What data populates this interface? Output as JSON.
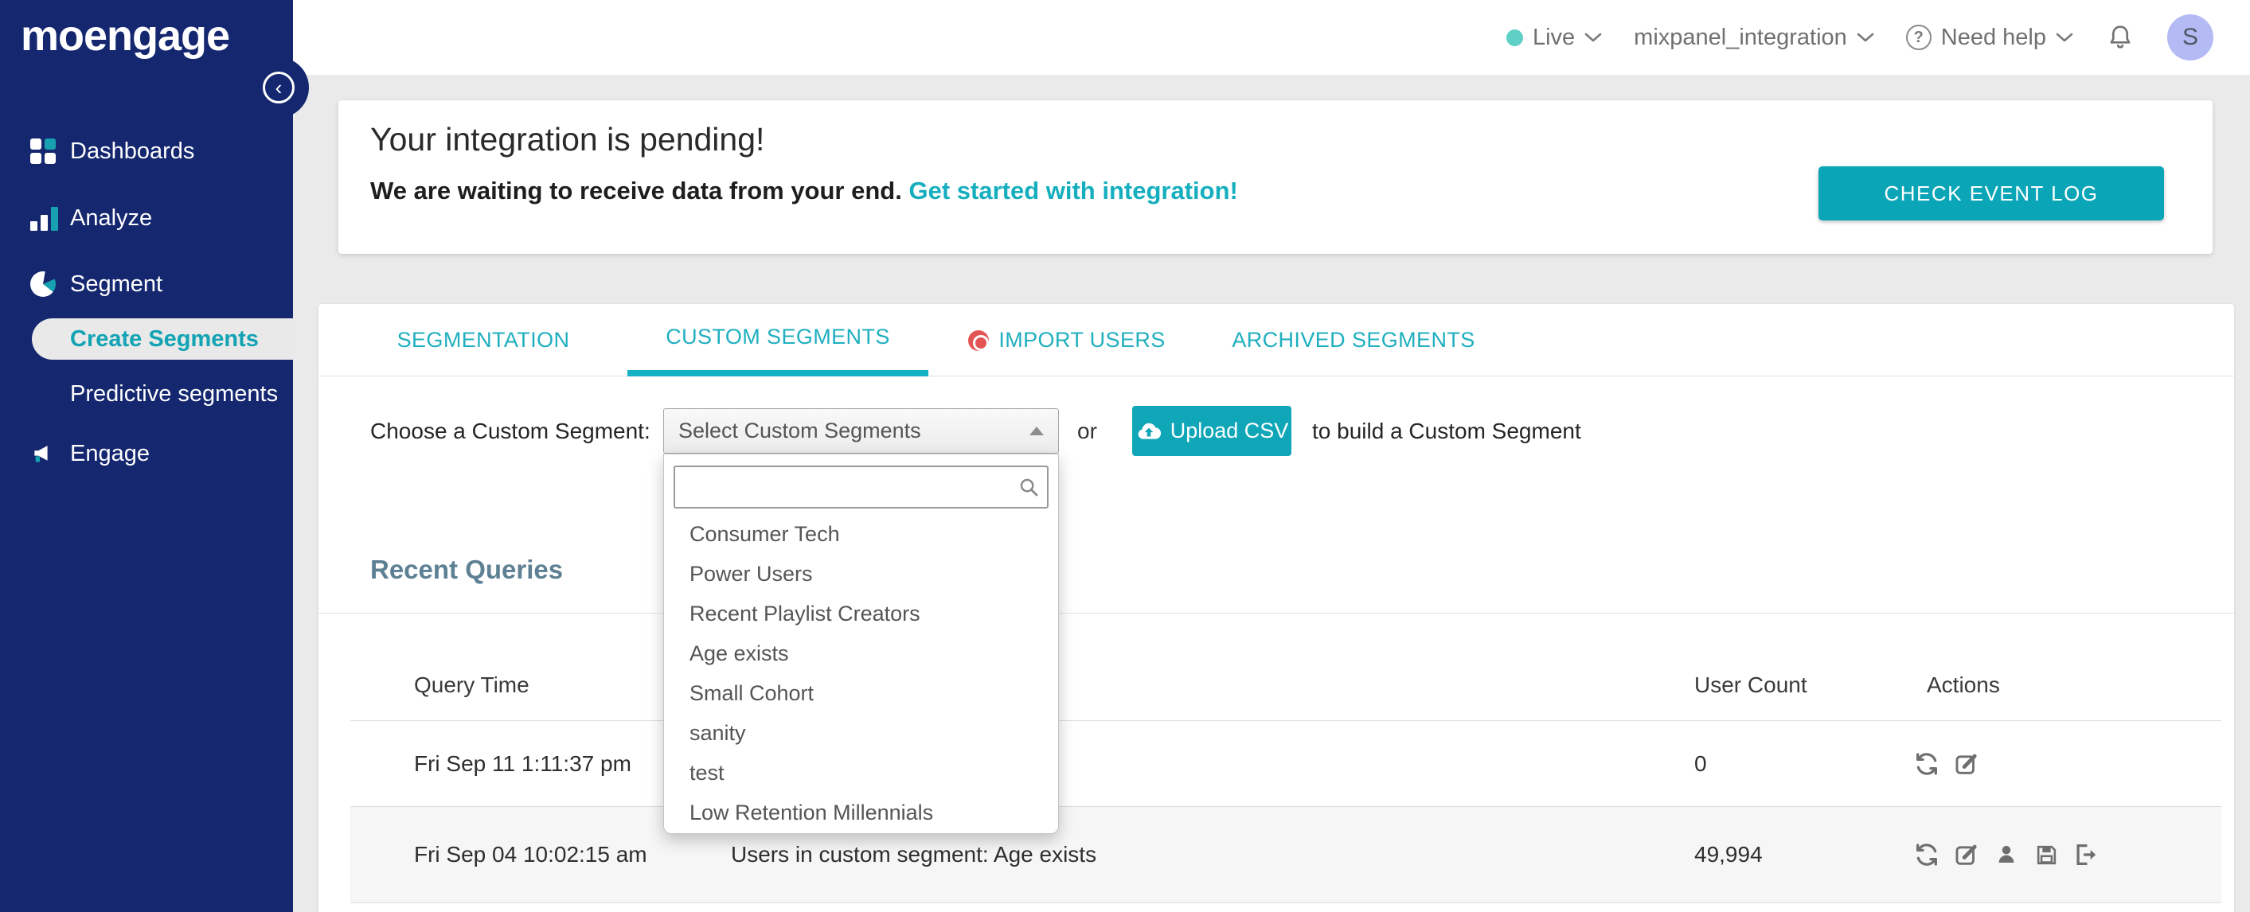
{
  "brand": {
    "logo_text": "moengage",
    "colors": {
      "navy": "#14276F",
      "teal": "#0FA7B8",
      "tab_teal": "#1FAFBF",
      "link_teal": "#14AEBE",
      "beacon_red": "#E25554",
      "live_dot": "#5ED0C5",
      "avatar_bg": "#B4BAF3",
      "heading_slate": "#5D8094"
    }
  },
  "sidebar": {
    "collapse_icon": "chevron-left-icon",
    "items": [
      {
        "label": "Dashboards",
        "icon": "grid-icon"
      },
      {
        "label": "Analyze",
        "icon": "bar-chart-icon"
      },
      {
        "label": "Segment",
        "icon": "pie-chart-icon"
      },
      {
        "label": "Create Segments",
        "icon": "none",
        "active": true
      },
      {
        "label": "Predictive segments",
        "icon": "none"
      },
      {
        "label": "Engage",
        "icon": "megaphone-icon"
      }
    ]
  },
  "header": {
    "environment": "Live",
    "workspace": "mixpanel_integration",
    "help": "Need help",
    "icons": [
      "status-dot",
      "chevron-down-icon",
      "question-circle-icon",
      "bell-icon"
    ],
    "avatar_initial": "S"
  },
  "banner": {
    "title": "Your integration is pending!",
    "subtitle": "We are waiting to receive data from your end.",
    "link": "Get started with integration!",
    "button": "CHECK EVENT LOG"
  },
  "tabs": [
    {
      "label": "SEGMENTATION",
      "active": false
    },
    {
      "label": "CUSTOM SEGMENTS",
      "active": true
    },
    {
      "label": "IMPORT USERS",
      "active": false,
      "beacon": "beacon-icon"
    },
    {
      "label": "ARCHIVED SEGMENTS",
      "active": false
    }
  ],
  "chooser": {
    "label": "Choose a Custom Segment:",
    "select_value": "Select Custom Segments",
    "select_icon": "caret-up-icon",
    "or_text": "or",
    "upload_button": "Upload CSV",
    "upload_icon": "cloud-upload-icon",
    "suffix_text": "to build a Custom Segment"
  },
  "dropdown": {
    "search_value": "",
    "search_icon": "search-icon",
    "items": [
      "Consumer Tech",
      "Power Users",
      "Recent Playlist Creators",
      "Age exists",
      "Small Cohort",
      "sanity",
      "test",
      "Low Retention Millennials"
    ]
  },
  "recent_queries": {
    "title": "Recent Queries",
    "columns": {
      "query_time": "Query Time",
      "query": "",
      "user_count": "User Count",
      "actions": "Actions"
    },
    "rows": [
      {
        "query_time": "Fri Sep 11 1:11:37 pm",
        "query": "",
        "user_count": "0",
        "actions": [
          "refresh-icon",
          "edit-icon"
        ]
      },
      {
        "query_time": "Fri Sep 04 10:02:15 am",
        "query": "Users in custom segment: Age exists",
        "user_count": "49,994",
        "actions": [
          "refresh-icon",
          "edit-icon",
          "user-icon",
          "save-icon",
          "export-icon"
        ]
      }
    ]
  }
}
